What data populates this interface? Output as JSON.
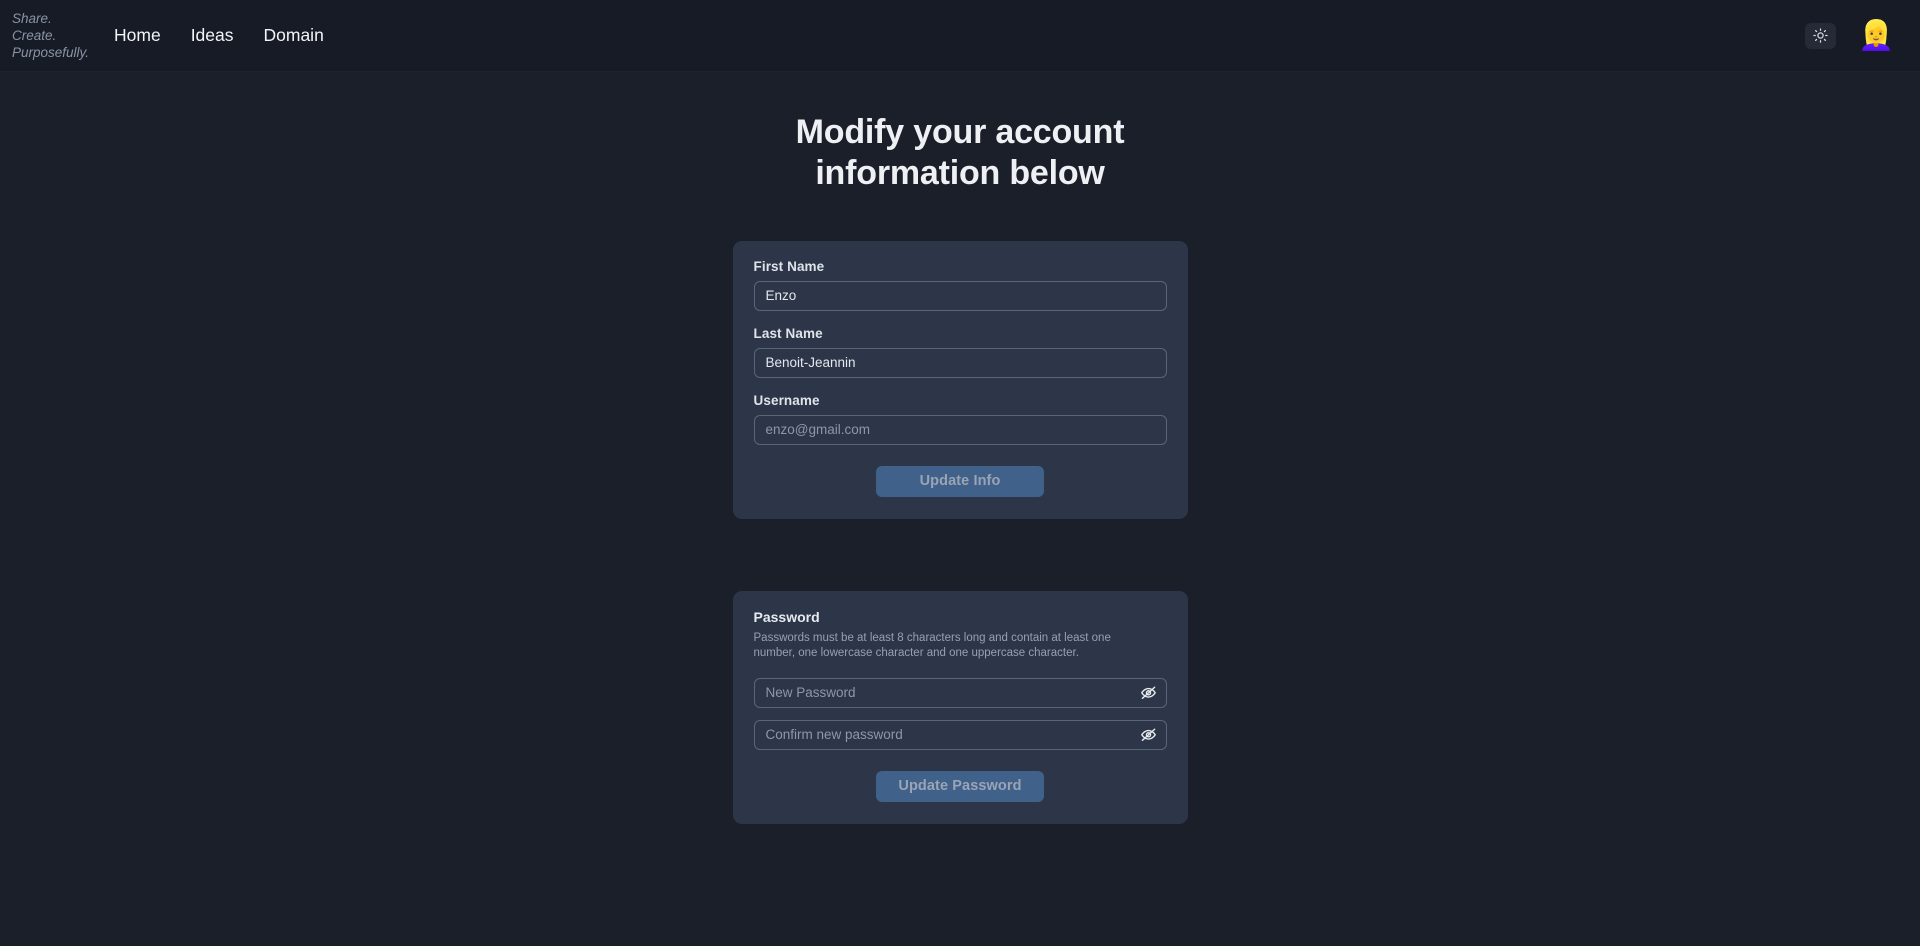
{
  "header": {
    "tagline": [
      "Share.",
      "Create.",
      "Purposefully."
    ],
    "nav": [
      {
        "label": "Home"
      },
      {
        "label": "Ideas"
      },
      {
        "label": "Domain"
      }
    ],
    "theme_toggle_icon": "sun-icon",
    "avatar_emoji": "👱‍♀️"
  },
  "main": {
    "title_line1": "Modify your account",
    "title_line2": "information below"
  },
  "info_card": {
    "first_name": {
      "label": "First Name",
      "value": "Enzo",
      "placeholder": "First Name"
    },
    "last_name": {
      "label": "Last Name",
      "value": "Benoit-Jeannin",
      "placeholder": "Last Name"
    },
    "username": {
      "label": "Username",
      "value": "",
      "placeholder": "enzo@gmail.com"
    },
    "submit_label": "Update Info"
  },
  "password_card": {
    "heading": "Password",
    "hint": "Passwords must be at least 8 characters long and contain at least one number, one lowercase character and one uppercase character.",
    "new_password": {
      "value": "",
      "placeholder": "New Password"
    },
    "confirm_password": {
      "value": "",
      "placeholder": "Confirm new password"
    },
    "toggle_icon": "eye-off-icon",
    "submit_label": "Update Password"
  },
  "colors": {
    "page_background": "#1b1f2a",
    "header_background": "#171b26",
    "card_background": "#2d3648",
    "button_blue": "#40618a",
    "button_disabled_text": "#9aa4b5",
    "input_border": "#5b6578",
    "muted_text": "#8a93a6"
  }
}
